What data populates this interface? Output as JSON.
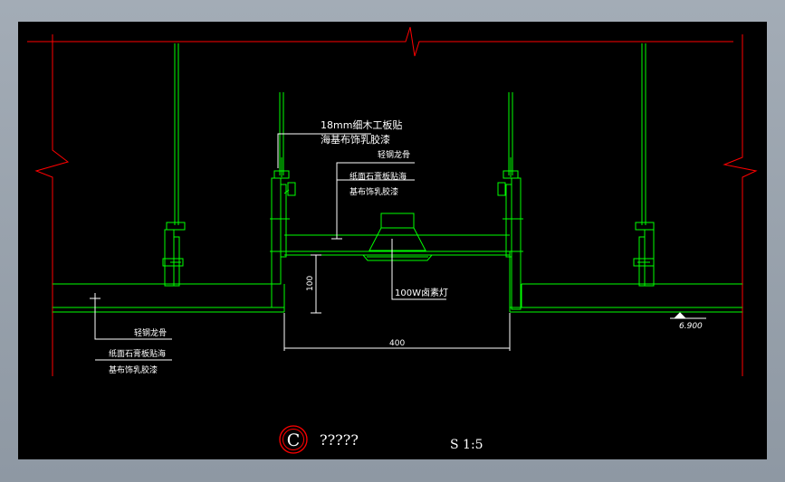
{
  "annotations": {
    "panel_top_line1": "18mm细木工板贴",
    "panel_top_line2": "海基布饰乳胶漆",
    "keel_right": "轻钢龙骨",
    "board_right_line1": "纸面石膏板贴海",
    "board_right_line2": "基布饰乳胶漆",
    "lamp": "100W卤素灯",
    "keel_left": "轻钢龙骨",
    "board_left_line1": "纸面石膏板贴海",
    "board_left_line2": "基布饰乳胶漆"
  },
  "dimensions": {
    "height": "100",
    "width": "400",
    "level": "6.900"
  },
  "title_block": {
    "section_letter": "C",
    "section_name": "?????",
    "scale": "S 1:5"
  },
  "colors": {
    "structure": "#00ff00",
    "boundary": "#ff0000",
    "annotation": "#ffffff",
    "background": "#000000"
  }
}
